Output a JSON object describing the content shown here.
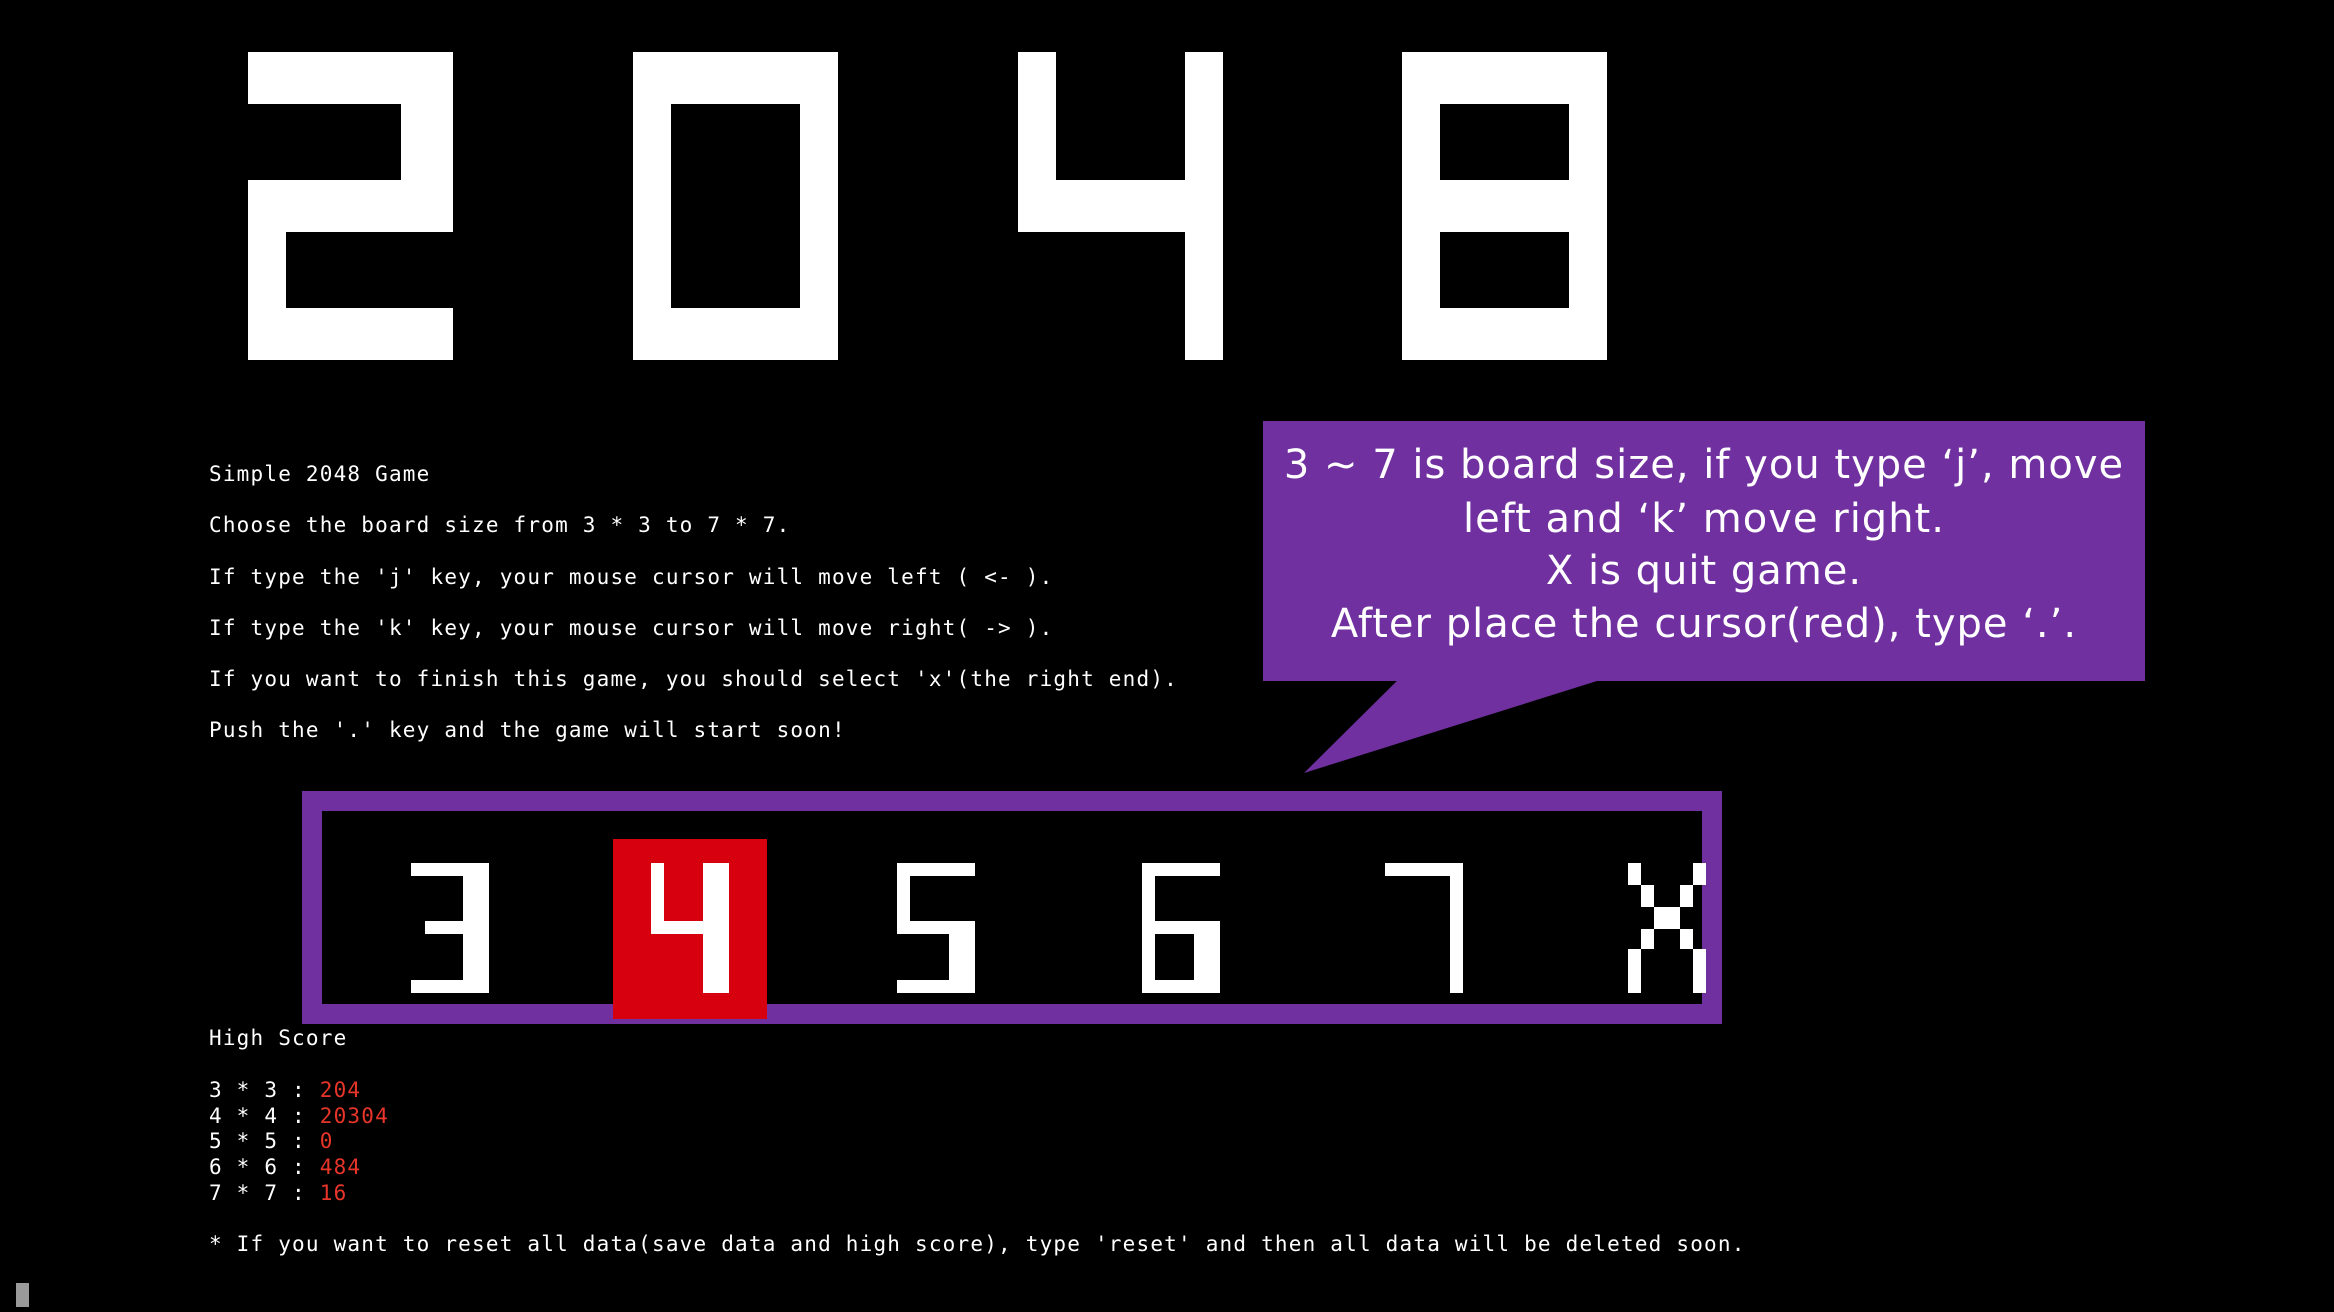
{
  "title": "2048",
  "intro": {
    "lines": [
      "Simple 2048 Game",
      "Choose the board size from 3 * 3 to 7 * 7.",
      "If type the 'j' key, your mouse cursor will move left ( <- ).",
      "If type the 'k' key, your mouse cursor will move right( -> ).",
      "If you want to finish this game, you should select 'x'(the right end).",
      "Push the '.' key and the game will start soon!"
    ]
  },
  "callout": {
    "lines": [
      "3 ~ 7 is board size, if you type ‘j’, move",
      "left and ‘k’ move right.",
      "X is quit game.",
      "After place the cursor(red), type ‘.’."
    ],
    "color": "#7030A0"
  },
  "selector": {
    "options": [
      "3",
      "4",
      "5",
      "6",
      "7",
      "X"
    ],
    "selected": "4",
    "selected_color": "#D7000F",
    "frame_color": "#7030A0"
  },
  "high_score": {
    "heading": "High Score",
    "rows": [
      {
        "label": "3 * 3 : ",
        "value": "204"
      },
      {
        "label": "4 * 4 : ",
        "value": "20304"
      },
      {
        "label": "5 * 5 : ",
        "value": "0"
      },
      {
        "label": "6 * 6 : ",
        "value": "484"
      },
      {
        "label": "7 * 7 : ",
        "value": "16"
      }
    ],
    "value_color": "#E8352A"
  },
  "reset_note": "* If you want to reset all data(save data and high score), type 'reset' and then all data will be deleted soon."
}
